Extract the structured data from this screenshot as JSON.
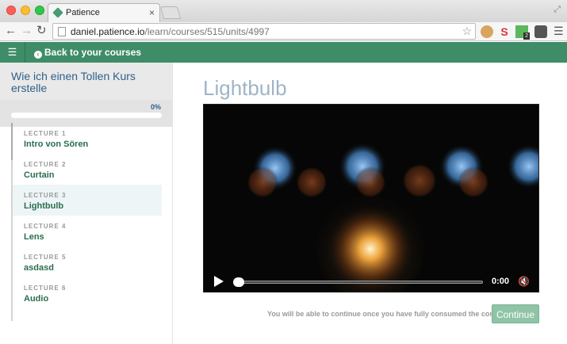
{
  "browser": {
    "tab_title": "Patience",
    "tab_close": "×",
    "url_host": "daniel.patience.io",
    "url_path": "/learn/courses/515/units/4997",
    "ext_s_label": "S",
    "ext_badge": "2"
  },
  "header": {
    "back_label": "Back to your courses"
  },
  "sidebar": {
    "course_title": "Wie ich einen Tollen Kurs erstelle",
    "progress_label": "0%",
    "progress_value": 0,
    "lectures": [
      {
        "num": "LECTURE 1",
        "name": "Intro von Sören"
      },
      {
        "num": "LECTURE 2",
        "name": "Curtain"
      },
      {
        "num": "LECTURE 3",
        "name": "Lightbulb"
      },
      {
        "num": "LECTURE 4",
        "name": "Lens"
      },
      {
        "num": "LECTURE 5",
        "name": "asdasd"
      },
      {
        "num": "LECTURE 6",
        "name": "Audio"
      }
    ]
  },
  "main": {
    "title": "Lightbulb",
    "video_time": "0:00",
    "continue_note": "You will be able to continue once you have fully consumed the content",
    "continue_label": "Continue"
  },
  "colors": {
    "brand_green": "#3f8d68",
    "title_blue": "#9fb4c7"
  }
}
